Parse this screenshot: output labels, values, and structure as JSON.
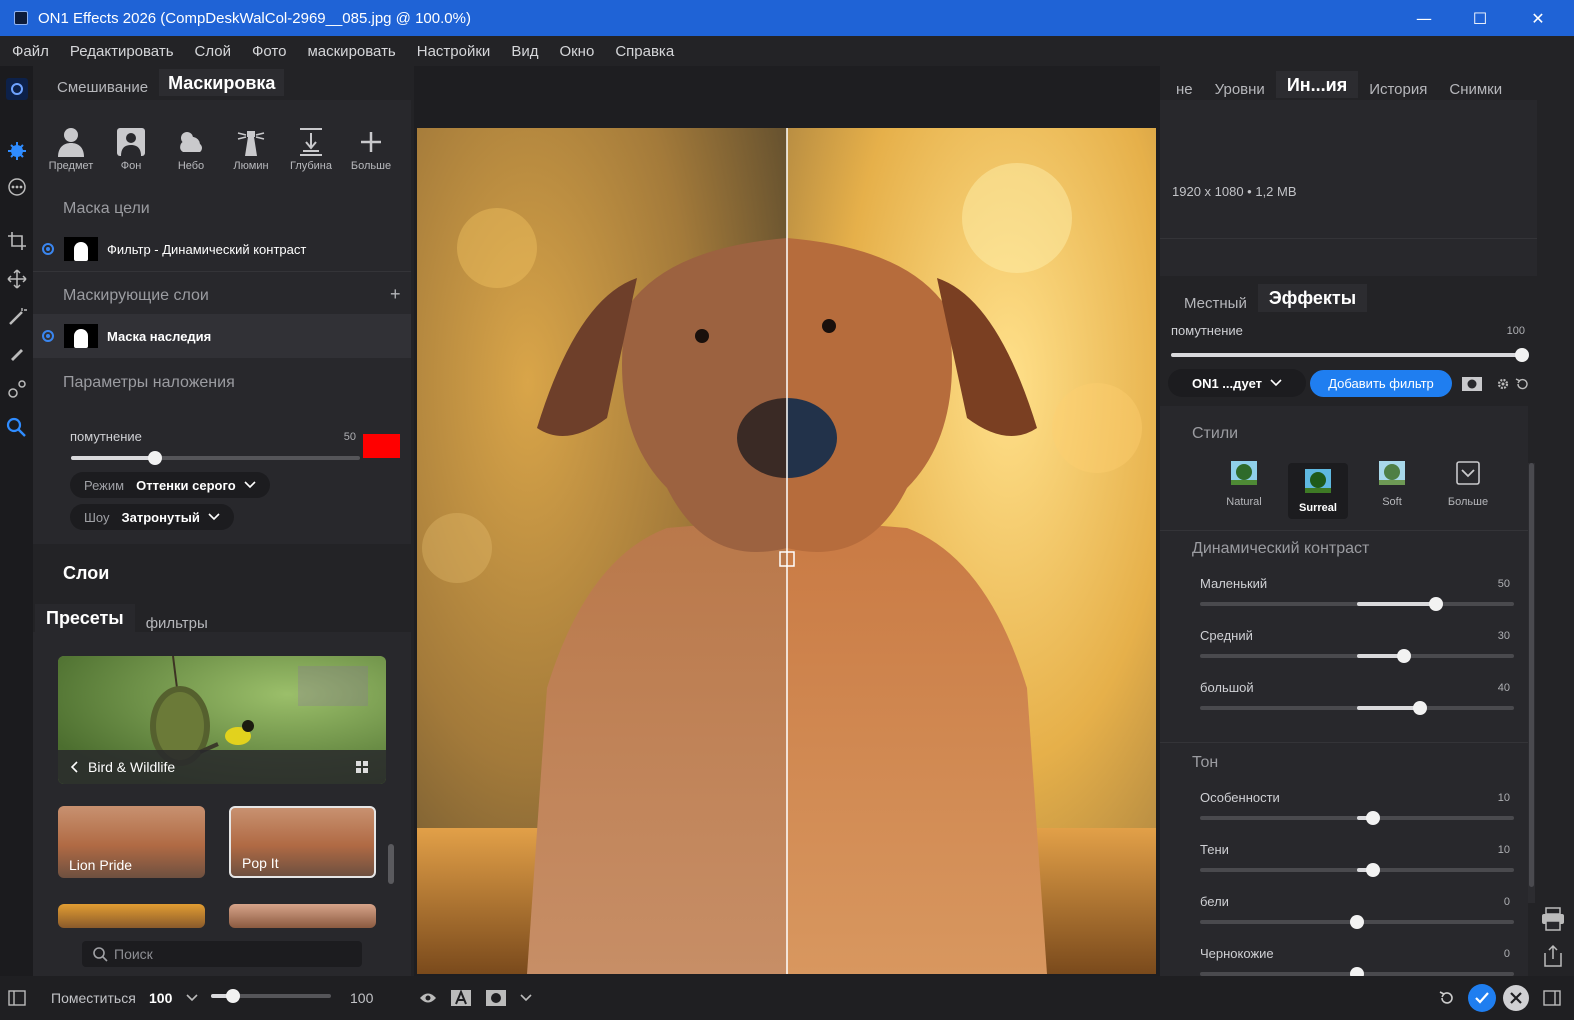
{
  "window": {
    "title": "ON1 Effects 2026 (CompDeskWalCol-2969__085.jpg @ 100.0%)"
  },
  "menu": [
    "Файл",
    "Редактировать",
    "Слой",
    "Фото",
    "маскировать",
    "Настройки",
    "Вид",
    "Окно",
    "Справка"
  ],
  "left_tabs": {
    "blend": "Смешивание",
    "mask": "Маскировка"
  },
  "mask_tools": [
    "Предмет",
    "Фон",
    "Небо",
    "Люмин",
    "Глубина",
    "Больше"
  ],
  "target_mask": {
    "heading": "Маска цели",
    "item": "Фильтр - Динамический контраст"
  },
  "mask_layers": {
    "heading": "Маскирующие слои",
    "add": "+",
    "item": "Маска наследия"
  },
  "overlay": {
    "heading": "Параметры наложения",
    "opacity_label": "помутнение",
    "opacity_value": "50",
    "opacity": 0.5,
    "color": "#ff0000",
    "mode_key": "Режим",
    "mode_value": "Оттенки серого",
    "show_key": "Шоу",
    "show_value": "Затронутый"
  },
  "layers_heading": "Слои",
  "preset_tabs": {
    "presets": "Пресеты",
    "filters": "фильтры"
  },
  "presets": {
    "category": "Bird & Wildlife",
    "items": [
      "Lion Pride",
      "Pop It"
    ],
    "search_placeholder": "Поиск"
  },
  "right_tabs": [
    "не",
    "Уровни",
    "Ин...ия",
    "История",
    "Снимки"
  ],
  "info": {
    "dimensions": "1920 x 1080 • 1,2 MB"
  },
  "effects_tabs": {
    "local": "Местный",
    "effects": "Эффекты"
  },
  "effect_opacity": {
    "label": "помутнение",
    "value": "100",
    "level": 1.0
  },
  "filter_select": "ON1 ...дует",
  "add_filter": "Добавить фильтр",
  "styles": {
    "heading": "Стили",
    "items": [
      "Natural",
      "Surreal",
      "Soft",
      "Больше"
    ],
    "selected": "Surreal"
  },
  "dynamic_contrast": {
    "heading": "Динамический контраст",
    "sliders": [
      {
        "label": "Маленький",
        "value": "50"
      },
      {
        "label": "Средний",
        "value": "30"
      },
      {
        "label": "большой",
        "value": "40"
      }
    ]
  },
  "tone": {
    "heading": "Тон",
    "sliders": [
      {
        "label": "Особенности",
        "value": "10"
      },
      {
        "label": "Тени",
        "value": "10"
      },
      {
        "label": "бели",
        "value": "0"
      },
      {
        "label": "Чернокожие",
        "value": "0"
      }
    ]
  },
  "bottom": {
    "fit_label": "Поместиться",
    "zoom_value": "100",
    "zoom_right": "100"
  },
  "colors": {
    "accent": "#1f63d6",
    "button_blue": "#1f7ef0",
    "swatch": "#ff0000"
  }
}
